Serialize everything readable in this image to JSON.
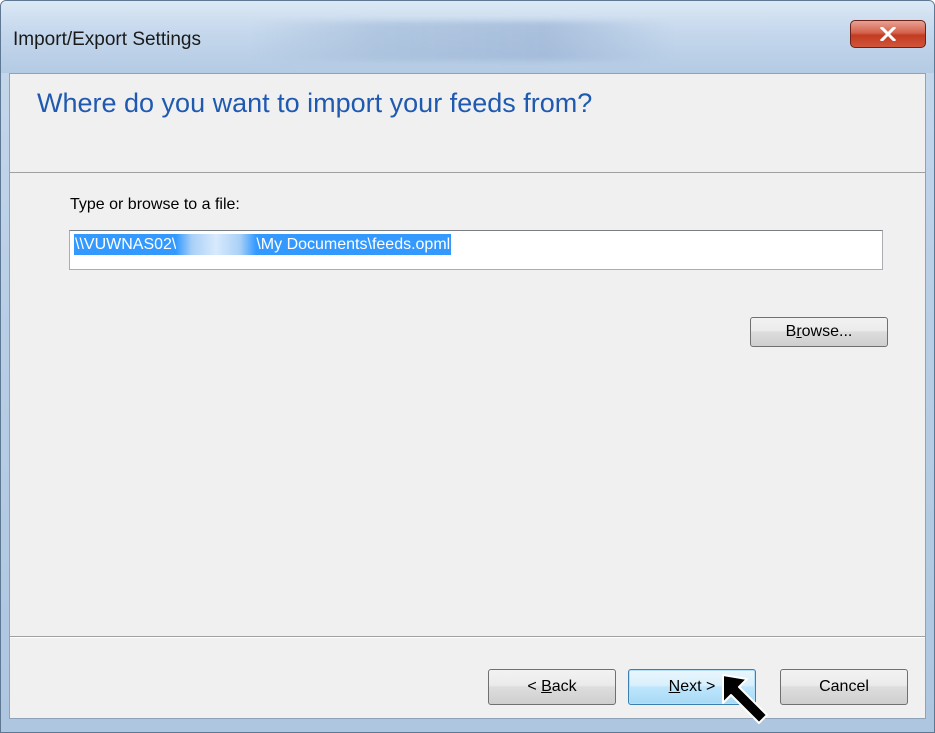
{
  "window": {
    "title": "Import/Export Settings",
    "close_label": "x"
  },
  "page": {
    "heading": "Where do you want to import your feeds from?",
    "file_label": "Type or browse to a file:",
    "path_prefix": "\\\\VUWNAS02\\",
    "path_suffix": "\\My Documents\\feeds.opml"
  },
  "buttons": {
    "browse": {
      "pre": "B",
      "underline": "r",
      "post": "owse..."
    },
    "back": {
      "pre": "< ",
      "underline": "B",
      "post": "ack"
    },
    "next": {
      "pre": "",
      "underline": "N",
      "post": "ext >"
    },
    "cancel": "Cancel"
  },
  "icons": {
    "close": "close-icon",
    "cursor": "mouse-pointer-icon"
  },
  "colors": {
    "heading": "#1f5ab0",
    "selection": "#3399ff",
    "close_button": "#c23b22"
  }
}
